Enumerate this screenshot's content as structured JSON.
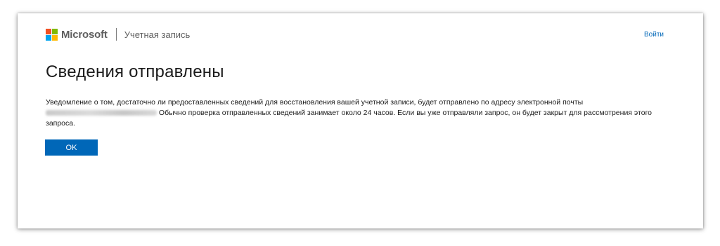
{
  "header": {
    "brand": "Microsoft",
    "section": "Учетная запись",
    "signin_label": "Войти",
    "logo_colors": [
      "#f25022",
      "#7fba00",
      "#00a4ef",
      "#ffb900"
    ]
  },
  "main": {
    "title": "Сведения отправлены",
    "message_part1": "Уведомление о том, достаточно ли предоставленных сведений для восстановления вашей учетной записи, будет отправлено по адресу электронной почты",
    "message_part2": " Обычно проверка отправленных сведений занимает около 24 часов. Если вы уже отправляли запрос, он будет закрыт для рассмотрения этого запроса.",
    "ok_label": "OK"
  },
  "colors": {
    "accent": "#0067b8"
  }
}
